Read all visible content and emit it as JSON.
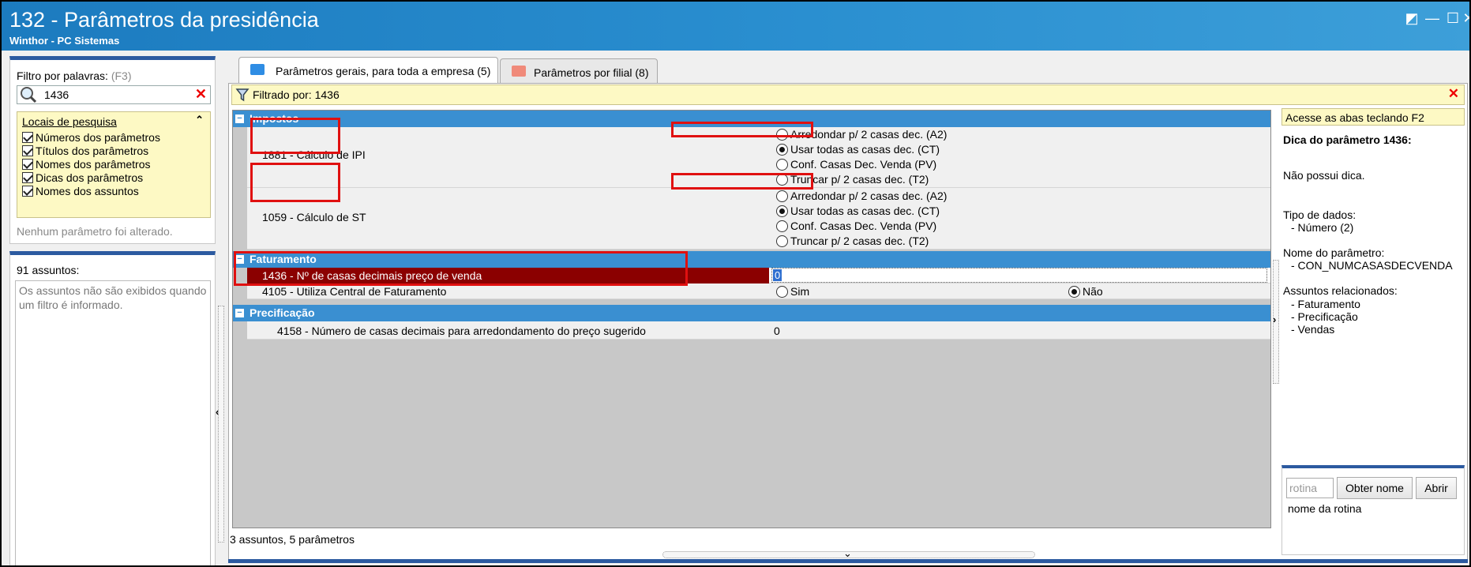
{
  "window": {
    "title": "132 - Parâmetros da presidência",
    "subtitle": "Winthor - PC Sistemas",
    "controls": {
      "restore": "◩",
      "minimize": "—",
      "maximize": "☐",
      "close": "✕"
    }
  },
  "filter": {
    "label": "Filtro por palavras:",
    "shortcut": "(F3)",
    "search_value": "1436",
    "clear_glyph": "✕",
    "locais_title": "Locais de pesquisa",
    "locais_collapse": "⌃",
    "locais": [
      {
        "label": "Números dos parâmetros",
        "checked": true
      },
      {
        "label": "Títulos dos parâmetros",
        "checked": true
      },
      {
        "label": "Nomes dos parâmetros",
        "checked": true
      },
      {
        "label": "Dicas dos parâmetros",
        "checked": true
      },
      {
        "label": "Nomes dos assuntos",
        "checked": true
      }
    ],
    "status": "Nenhum parâmetro foi alterado."
  },
  "subjects": {
    "count_label": "91 assuntos:",
    "message": "Os assuntos não são exibidos quando um filtro é informado."
  },
  "tabs": [
    {
      "label": "Parâmetros gerais, para toda a empresa  (5)",
      "active": true,
      "icon_color": "#2f8de4"
    },
    {
      "label": "Parâmetros por filial  (8)",
      "active": false,
      "icon_color": "#f08a7a"
    }
  ],
  "filterbar": {
    "text": "Filtrado por: 1436",
    "clear_glyph": "✕"
  },
  "groups": {
    "impostos": "Impostos",
    "faturamento": "Faturamento",
    "precificacao": "Precificação"
  },
  "params": {
    "p1881": {
      "name": "1881 - Cálculo de IPI",
      "options": [
        "Arredondar p/ 2 casas dec. (A2)",
        "Usar todas as casas dec. (CT)",
        "Conf. Casas Dec. Venda (PV)",
        "Truncar p/ 2 casas dec. (T2)"
      ],
      "selected": 1
    },
    "p1059": {
      "name": "1059 - Cálculo de ST",
      "options": [
        "Arredondar p/ 2 casas dec. (A2)",
        "Usar todas as casas dec. (CT)",
        "Conf. Casas Dec. Venda (PV)",
        "Truncar p/ 2 casas dec. (T2)"
      ],
      "selected": 1
    },
    "p1436": {
      "name": "1436 - Nº de casas decimais preço de venda",
      "value": "0"
    },
    "p4105": {
      "name": "4105 - Utiliza Central de Faturamento",
      "opt_yes": "Sim",
      "opt_no": "Não",
      "selected": "no"
    },
    "p4158": {
      "name": "4158 - Número de casas decimais para arredondamento do preço sugerido",
      "value": "0"
    }
  },
  "right_panel": {
    "hint_bar": "Acesse as abas teclando F2",
    "dica_title": "Dica do parâmetro 1436:",
    "dica_text": "Não possui dica.",
    "tipo_label": "Tipo de dados:",
    "tipo_value": "- Número (2)",
    "nome_label": "Nome do parâmetro:",
    "nome_value": "- CON_NUMCASASDECVENDA",
    "assuntos_label": "Assuntos relacionados:",
    "assuntos": [
      "- Faturamento",
      "- Precificação",
      "- Vendas"
    ],
    "rotina_placeholder": "rotina",
    "btn_obter": "Obter nome",
    "btn_abrir": "Abrir",
    "rotina_name": "nome da rotina"
  },
  "statusbar": "3 assuntos, 5 parâmetros",
  "colors": {
    "titlebar": "#1c7bbf",
    "group_header": "#3a8fd1",
    "selected_row": "#8b0000",
    "highlight": "#e01010",
    "yellow_panel": "#fdf9c4"
  }
}
